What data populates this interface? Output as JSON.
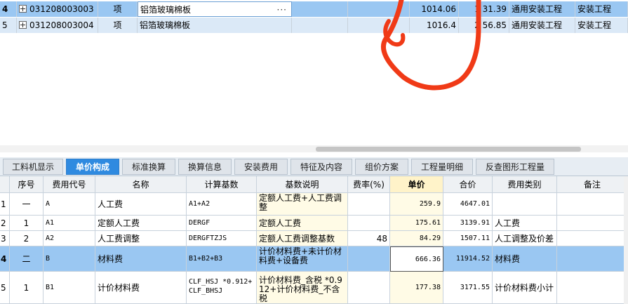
{
  "top_grid": {
    "rows": [
      {
        "rownum": "4",
        "code": "031208003003",
        "unit": "项",
        "name": "铝箔玻璃棉板",
        "price": "1014.06",
        "total": "1 31.39",
        "specialty": "通用安装工程",
        "category": "安装工程"
      },
      {
        "rownum": "5",
        "code": "031208003004",
        "unit": "项",
        "name": "铝箔玻璃棉板",
        "price": "1016.4",
        "total": "2 56.85",
        "specialty": "通用安装工程",
        "category": "安装工程"
      }
    ],
    "ellipsis": "···"
  },
  "tabs": [
    "工料机显示",
    "单价构成",
    "标准换算",
    "换算信息",
    "安装费用",
    "特征及内容",
    "组价方案",
    "工程量明细",
    "反查图形工程量"
  ],
  "active_tab": "单价构成",
  "price_table": {
    "columns": [
      "序号",
      "费用代号",
      "名称",
      "计算基数",
      "基数说明",
      "费率(%)",
      "单价",
      "合价",
      "费用类别",
      "备注"
    ],
    "rows": [
      {
        "rownum": "1",
        "seq": "一",
        "code": "A",
        "name": "人工费",
        "base": "A1+A2",
        "desc": "定额人工费+人工费调整",
        "rate": "",
        "unit_price": "259.9",
        "total": "4647.01",
        "category": "",
        "note": ""
      },
      {
        "rownum": "2",
        "seq": "1",
        "code": "A1",
        "name": "定额人工费",
        "base": "DERGF",
        "desc": "定额人工费",
        "rate": "",
        "unit_price": "175.61",
        "total": "3139.91",
        "category": "人工费",
        "note": ""
      },
      {
        "rownum": "3",
        "seq": "2",
        "code": "A2",
        "name": "人工费调整",
        "base": "DERGFTZJS",
        "desc": "定额人工费调整基数",
        "rate": "48",
        "unit_price": "84.29",
        "total": "1507.11",
        "category": "人工调整及价差",
        "note": ""
      },
      {
        "rownum": "4",
        "seq": "二",
        "code": "B",
        "name": "材料费",
        "base": "B1+B2+B3",
        "desc": "计价材料费+未计价材料费+设备费",
        "rate": "",
        "unit_price": "666.36",
        "total": "11914.52",
        "category": "材料费",
        "note": ""
      },
      {
        "rownum": "5",
        "seq": "1",
        "code": "B1",
        "name": "计价材料费",
        "base": "CLF_HSJ *0.912+CLF_BHSJ",
        "desc": "计价材料费_含税 *0.912+计价材料费_不含税",
        "rate": "",
        "unit_price": "177.38",
        "total": "3171.55",
        "category": "计价材料费小计",
        "note": ""
      }
    ]
  },
  "colors": {
    "selected_row": "#9ac7f2",
    "active_tab": "#2f8ae0",
    "annotation": "#f03a17",
    "unit_price_column": "#fffbe6"
  }
}
